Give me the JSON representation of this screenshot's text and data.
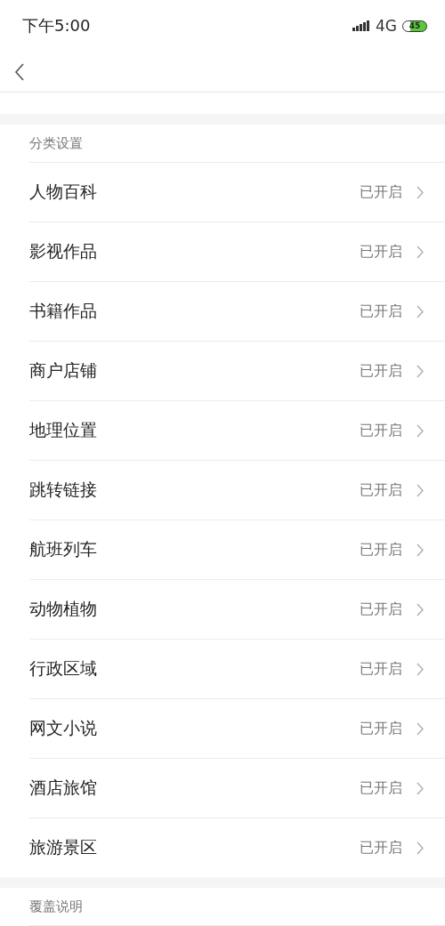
{
  "status_bar": {
    "time": "下午5:00",
    "network": "4G",
    "battery": "45"
  },
  "sections": [
    {
      "title": "分类设置",
      "items": [
        {
          "label": "人物百科",
          "status": "已开启"
        },
        {
          "label": "影视作品",
          "status": "已开启"
        },
        {
          "label": "书籍作品",
          "status": "已开启"
        },
        {
          "label": "商户店铺",
          "status": "已开启"
        },
        {
          "label": "地理位置",
          "status": "已开启"
        },
        {
          "label": "跳转链接",
          "status": "已开启"
        },
        {
          "label": "航班列车",
          "status": "已开启"
        },
        {
          "label": "动物植物",
          "status": "已开启"
        },
        {
          "label": "行政区域",
          "status": "已开启"
        },
        {
          "label": "网文小说",
          "status": "已开启"
        },
        {
          "label": "酒店旅馆",
          "status": "已开启"
        },
        {
          "label": "旅游景区",
          "status": "已开启"
        }
      ]
    },
    {
      "title": "覆盖说明"
    }
  ]
}
